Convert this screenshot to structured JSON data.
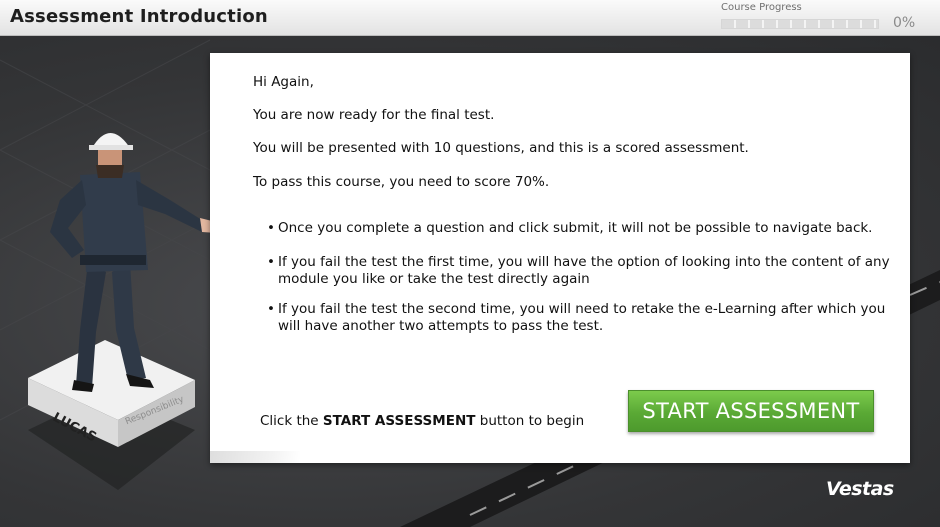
{
  "header": {
    "title": "Assessment Introduction",
    "progress_label": "Course Progress",
    "progress_value": "0%",
    "progress_fraction": 0
  },
  "intro": {
    "greeting": "Hi Again,",
    "line1": "You are now ready for the final test.",
    "line2": "You will be presented with 10 questions, and this is a scored assessment.",
    "line3": "To pass this course, you need to score 70%."
  },
  "rules": [
    {
      "text": "Once you complete a question and click submit, it will not be possible to navigate back."
    },
    {
      "text": "If you fail the test the first time, you will have the option of looking into the content of any module you like or take the test directly again"
    },
    {
      "text": "If you fail the test the second time, you will need to retake the e-Learning after which you will have another two attempts to pass the test."
    }
  ],
  "cta": {
    "prefix": "Click the ",
    "emphasis": "START ASSESSMENT",
    "suffix": " button to begin",
    "button_label": "START ASSESSMENT"
  },
  "character": {
    "name": "LUCAS",
    "tag": "Responsibility"
  },
  "brand": "Vestas",
  "colors": {
    "button_green": "#5aa935",
    "background": "#3a3b3d",
    "progress_fill": "#6aa83a"
  },
  "bullet_glyph": "•"
}
